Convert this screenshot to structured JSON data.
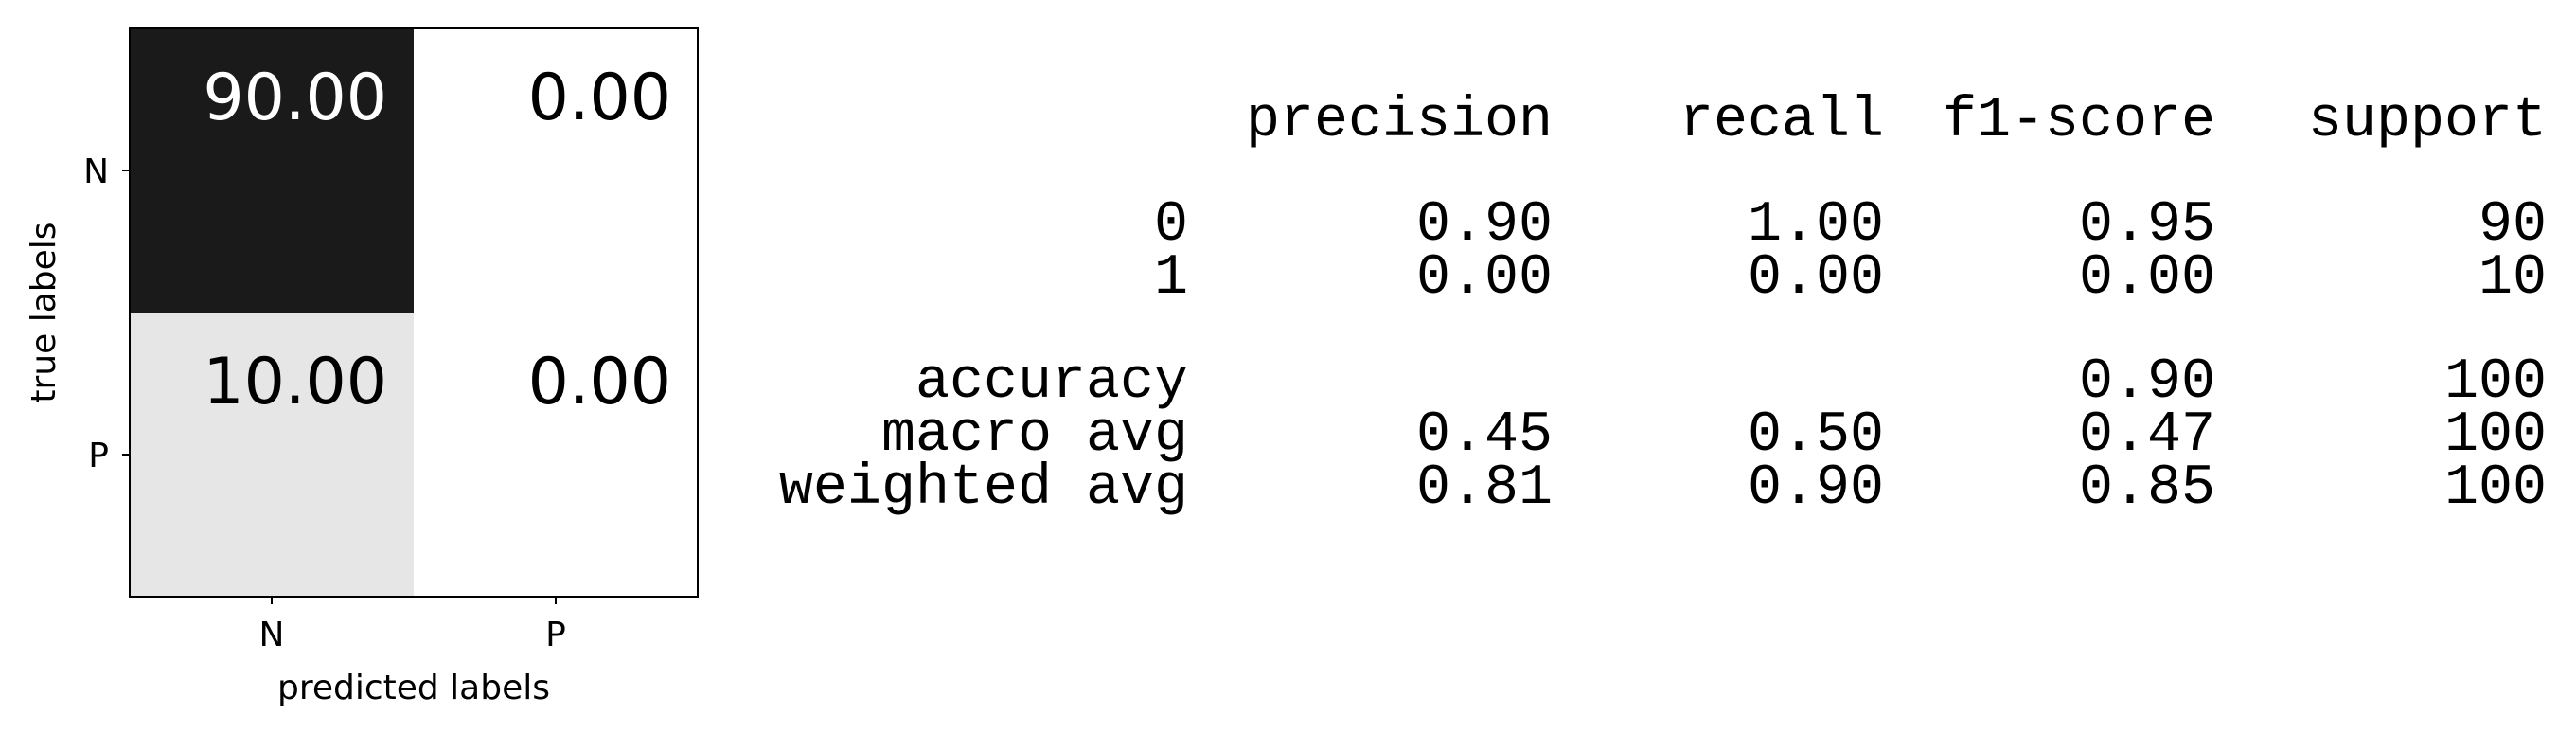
{
  "chart_data": [
    {
      "type": "heatmap",
      "title": "",
      "xlabel": "predicted labels",
      "ylabel": "true labels",
      "x_categories": [
        "N",
        "P"
      ],
      "y_categories": [
        "N",
        "P"
      ],
      "values": [
        [
          90.0,
          0.0
        ],
        [
          10.0,
          0.0
        ]
      ],
      "value_labels": [
        [
          "90.00",
          "0.00"
        ],
        [
          "10.00",
          "0.00"
        ]
      ],
      "colormap": "greys",
      "vmin": 0,
      "vmax": 90
    },
    {
      "type": "table",
      "columns": [
        "",
        "precision",
        "recall",
        "f1-score",
        "support"
      ],
      "class_rows": [
        [
          "0",
          "0.90",
          "1.00",
          "0.95",
          "90"
        ],
        [
          "1",
          "0.00",
          "0.00",
          "0.00",
          "10"
        ]
      ],
      "summary_rows": [
        [
          "accuracy",
          "",
          "",
          "0.90",
          "100"
        ],
        [
          "macro avg",
          "0.45",
          "0.50",
          "0.47",
          "100"
        ],
        [
          "weighted avg",
          "0.81",
          "0.90",
          "0.85",
          "100"
        ]
      ]
    }
  ]
}
